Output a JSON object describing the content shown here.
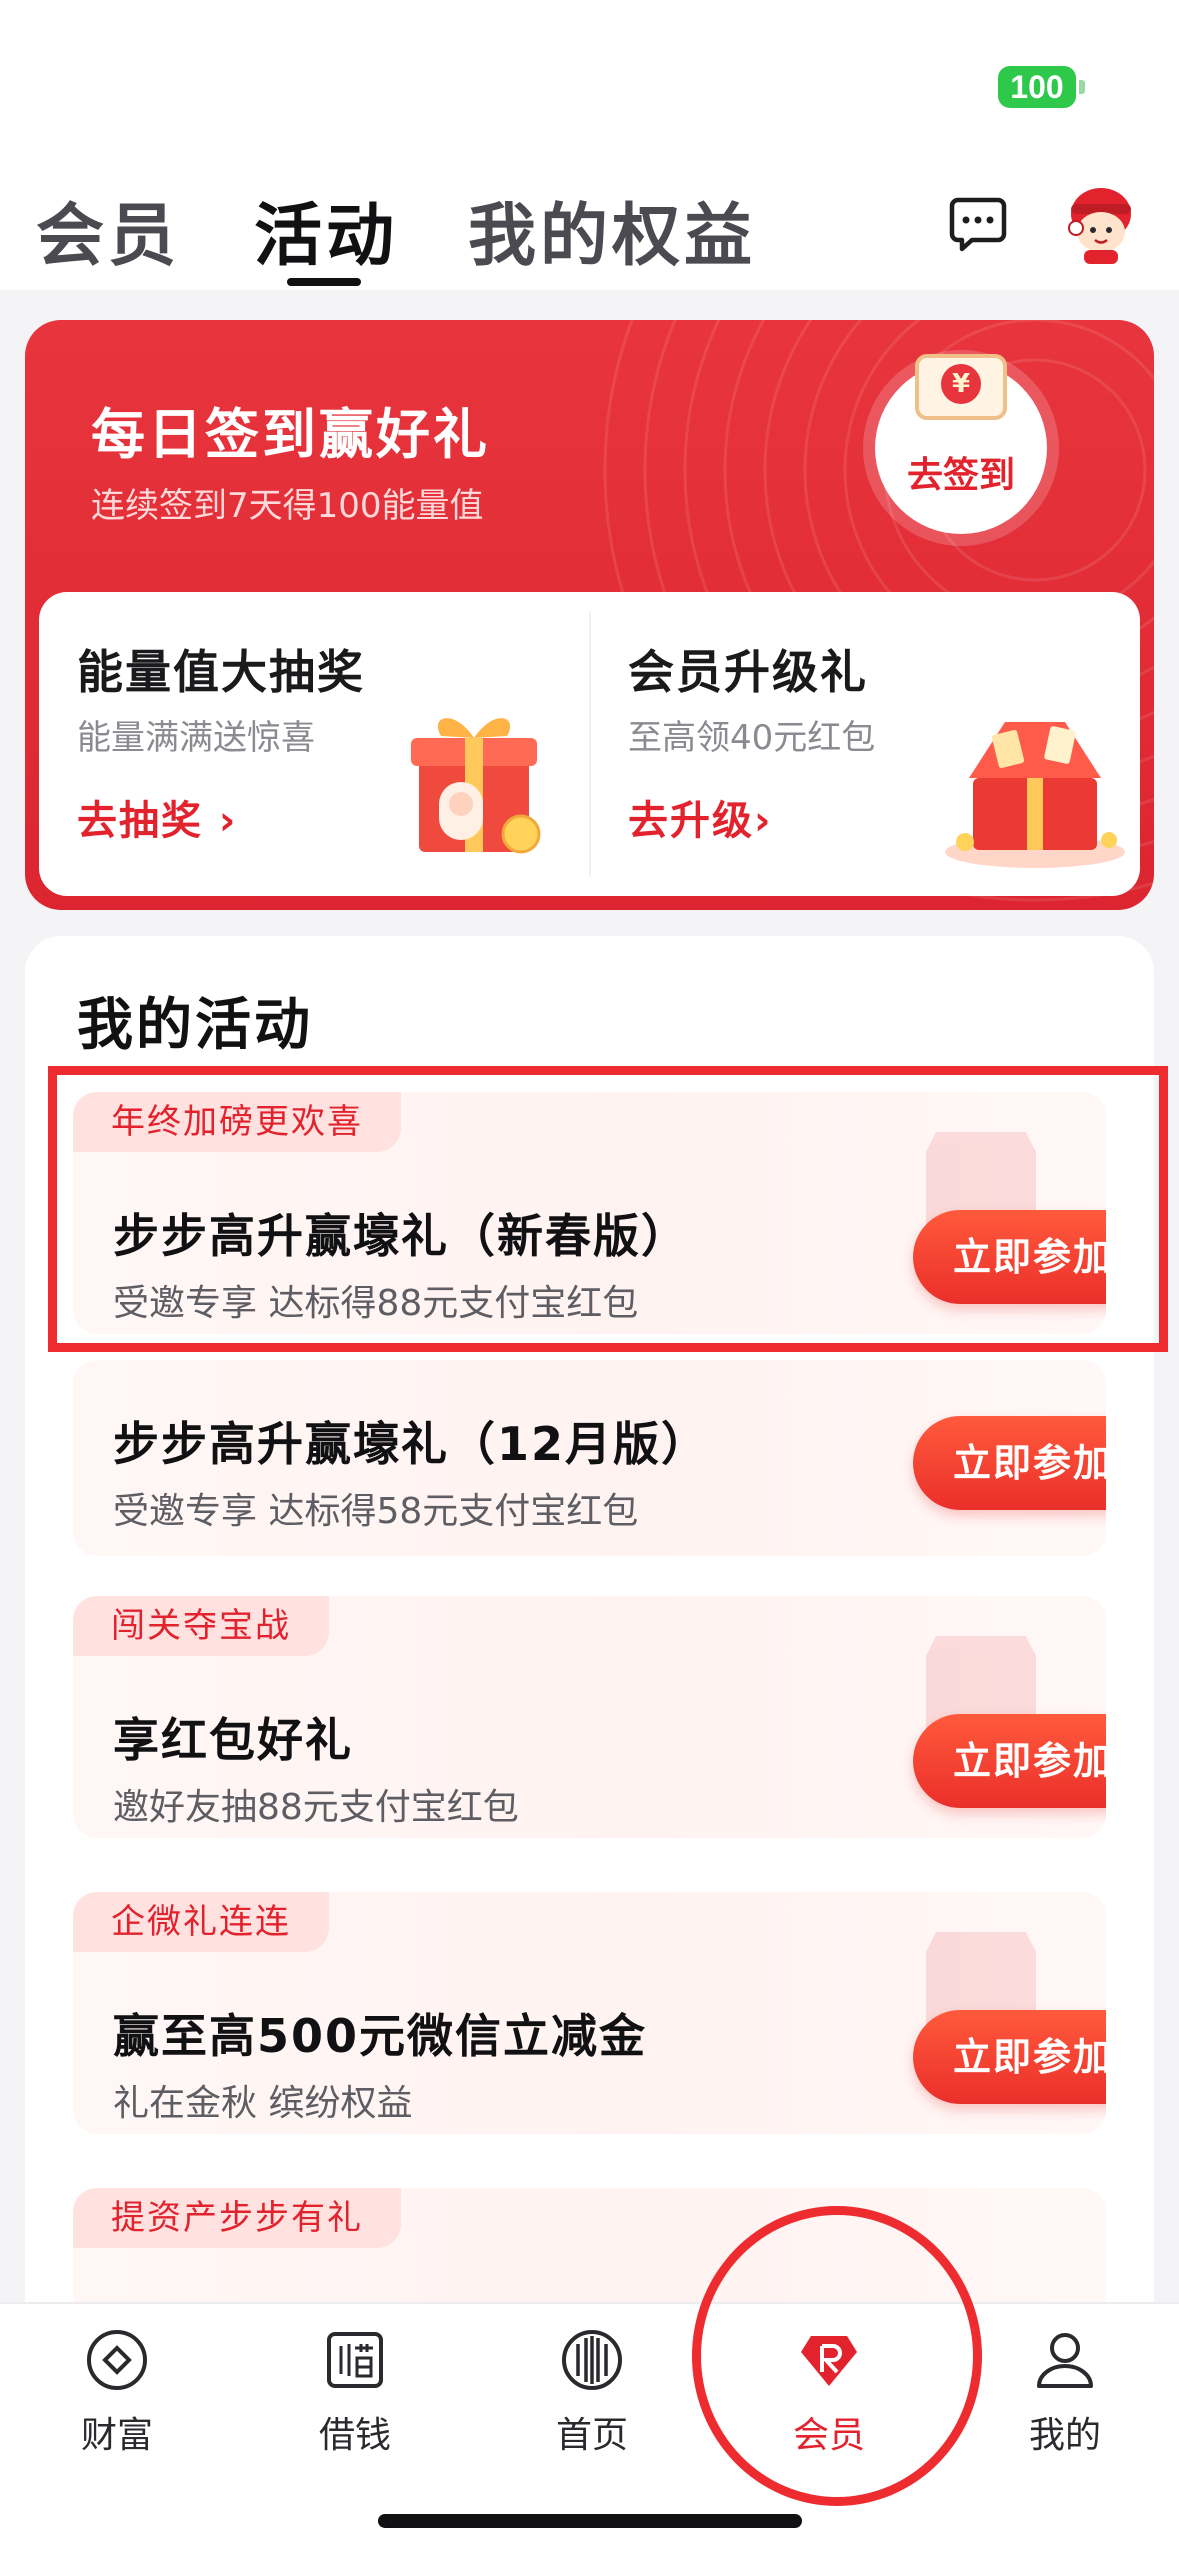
{
  "status_bar": {
    "battery": "100"
  },
  "header": {
    "tabs": [
      {
        "label": "会员"
      },
      {
        "label": "活动"
      },
      {
        "label": "我的权益"
      }
    ]
  },
  "banner": {
    "title": "每日签到赢好礼",
    "subtitle": "连续签到7天得100能量值",
    "signin_button": "去签到",
    "coin_symbol": "¥",
    "promos": [
      {
        "title": "能量值大抽奖",
        "subtitle": "能量满满送惊喜",
        "link": "去抽奖 ›"
      },
      {
        "title": "会员升级礼",
        "subtitle": "至高领40元红包",
        "link": "去升级›"
      }
    ]
  },
  "activities": {
    "heading": "我的活动",
    "items": [
      {
        "tag": "年终加磅更欢喜",
        "title": "步步高升赢壕礼（新春版）",
        "subtitle": "受邀专享 达标得88元支付宝红包",
        "button": "立即参加"
      },
      {
        "tag": "",
        "title": "步步高升赢壕礼（12月版）",
        "subtitle": "受邀专享 达标得58元支付宝红包",
        "button": "立即参加"
      },
      {
        "tag": "闯关夺宝战",
        "title": "享红包好礼",
        "subtitle": "邀好友抽88元支付宝红包",
        "button": "立即参加"
      },
      {
        "tag": "企微礼连连",
        "title": "赢至高500元微信立减金",
        "subtitle": "礼在金秋 缤纷权益",
        "button": "立即参加"
      },
      {
        "tag": "提资产步步有礼",
        "title": "",
        "subtitle": "",
        "button": ""
      }
    ]
  },
  "bottom_nav": {
    "items": [
      {
        "label": "财富",
        "icon": "wealth-icon"
      },
      {
        "label": "借钱",
        "icon": "borrow-icon"
      },
      {
        "label": "首页",
        "icon": "home-icon"
      },
      {
        "label": "会员",
        "icon": "member-gem-icon",
        "active": true
      },
      {
        "label": "我的",
        "icon": "profile-icon"
      }
    ]
  },
  "colors": {
    "brand_red": "#e2232e",
    "battery_green": "#2ec94a",
    "highlight": "#ee2b2f"
  }
}
